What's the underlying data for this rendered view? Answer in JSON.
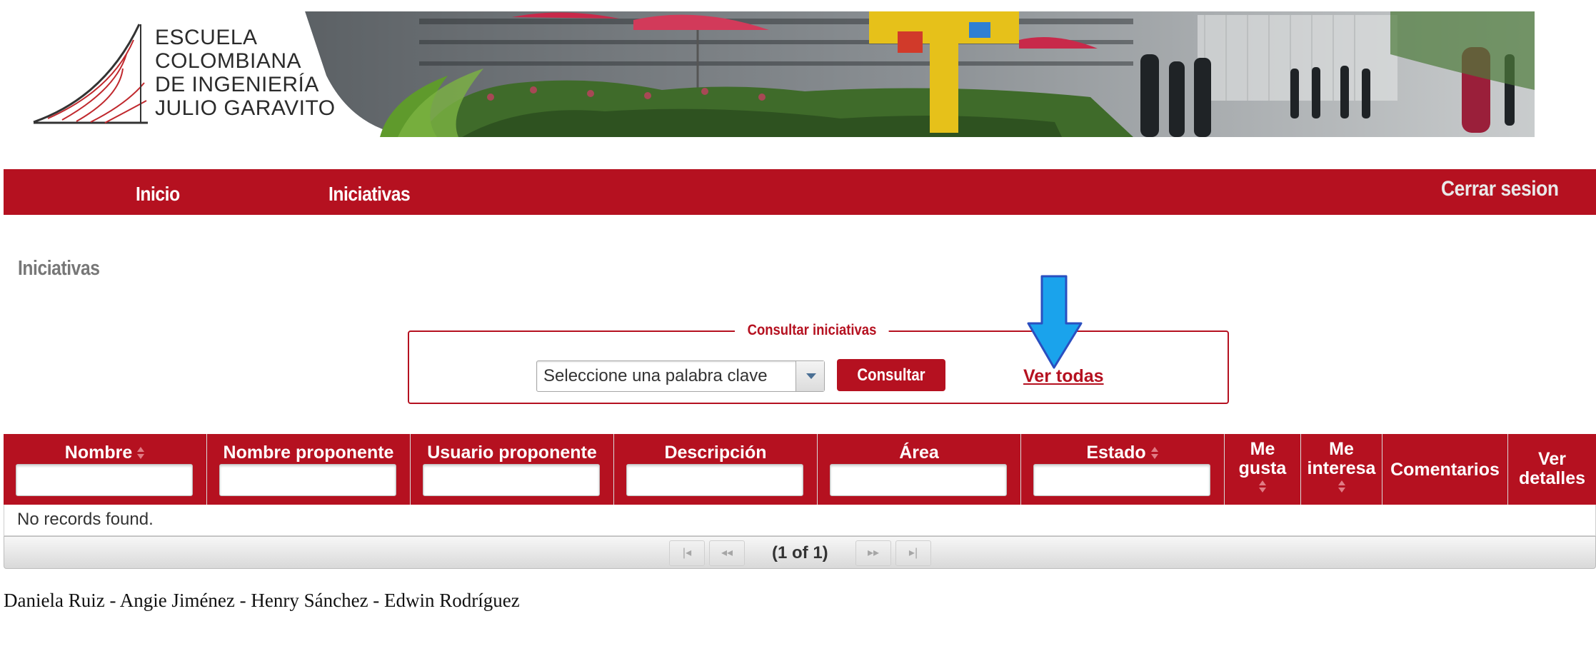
{
  "logo": {
    "lines": [
      "ESCUELA",
      "COLOMBIANA",
      "DE INGENIERÍA",
      "JULIO GARAVITO"
    ]
  },
  "nav": {
    "inicio": "Inicio",
    "iniciativas": "Iniciativas",
    "cerrar_sesion": "Cerrar sesion"
  },
  "page": {
    "title": "Iniciativas"
  },
  "search": {
    "legend": "Consultar iniciativas",
    "keyword_selected": "Seleccione una palabra clave",
    "consultar_label": "Consultar",
    "ver_todas_label": "Ver todas"
  },
  "table": {
    "columns": {
      "nombre": "Nombre",
      "nombre_proponente": "Nombre proponente",
      "usuario_proponente": "Usuario proponente",
      "descripcion": "Descripción",
      "area": "Área",
      "estado": "Estado",
      "me_gusta_1": "Me",
      "me_gusta_2": "gusta",
      "me_interesa_1": "Me",
      "me_interesa_2": "interesa",
      "comentarios": "Comentarios",
      "ver_detalles_1": "Ver",
      "ver_detalles_2": "detalles"
    },
    "empty_message": "No records found.",
    "paginator": {
      "status": "(1 of 1)"
    }
  },
  "footer": {
    "authors": "Daniela Ruiz - Angie Jiménez - Henry Sánchez - Edwin Rodríguez"
  },
  "colors": {
    "brand_red": "#b51120",
    "annotation_arrow": "#1aa3ec"
  }
}
